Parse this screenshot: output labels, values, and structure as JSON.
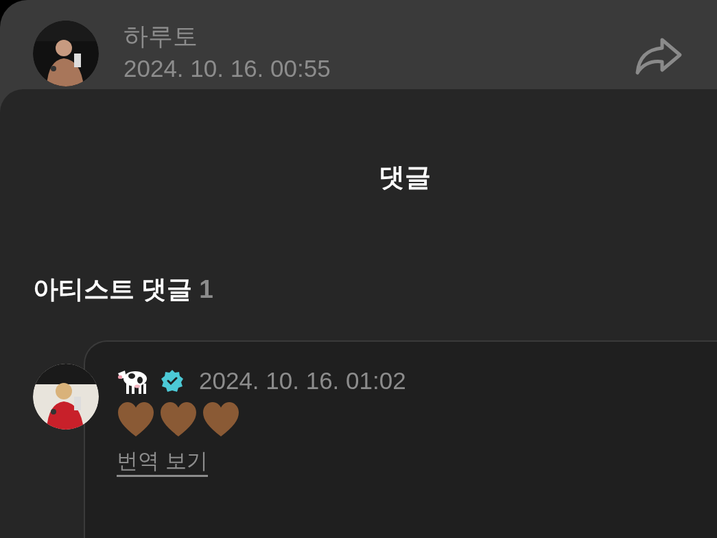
{
  "post": {
    "author": "하루토",
    "time": "2024. 10. 16. 00:55"
  },
  "sheet": {
    "title": "댓글"
  },
  "section": {
    "label": "아티스트 댓글",
    "count": "1"
  },
  "comments": [
    {
      "name_icon": {
        "kind": "cow"
      },
      "verified": true,
      "time": "2024. 10. 16. 01:02",
      "body_icons": [
        {
          "kind": "heart"
        },
        {
          "kind": "heart"
        },
        {
          "kind": "heart"
        }
      ],
      "translate": "번역 보기"
    }
  ]
}
